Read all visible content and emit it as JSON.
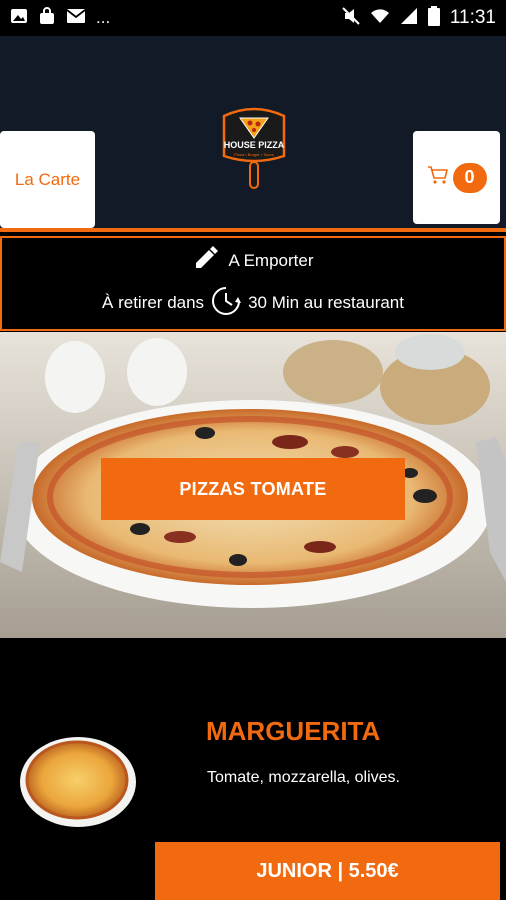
{
  "status_bar": {
    "left_icons": [
      "photo-icon",
      "bag-icon",
      "mail-icon"
    ],
    "more": "...",
    "right_icons": [
      "mute-icon",
      "wifi-icon",
      "signal-icon",
      "battery-icon"
    ],
    "time": "11:31"
  },
  "header": {
    "carte_label": "La Carte",
    "cart_count": "0",
    "logo_name": "HOUSE PIZZA",
    "logo_tagline": "Pizza • Burger • Tacos",
    "cart_icon": "cart-icon"
  },
  "banner": {
    "mode_label": "A Emporter",
    "pickup_prefix": "À retirer dans",
    "pickup_suffix": "30 Min au restaurant",
    "icons": [
      "pencil-icon",
      "clock-icon"
    ]
  },
  "category": {
    "button_label": "PIZZAS TOMATE"
  },
  "product": {
    "title": "MARGUERITA",
    "description": "Tomate, mozzarella, olives.",
    "price_label": "JUNIOR | 5.50€"
  },
  "colors": {
    "accent": "#f26a0f",
    "header_bg": "#111a26",
    "page_bg": "#000000"
  }
}
